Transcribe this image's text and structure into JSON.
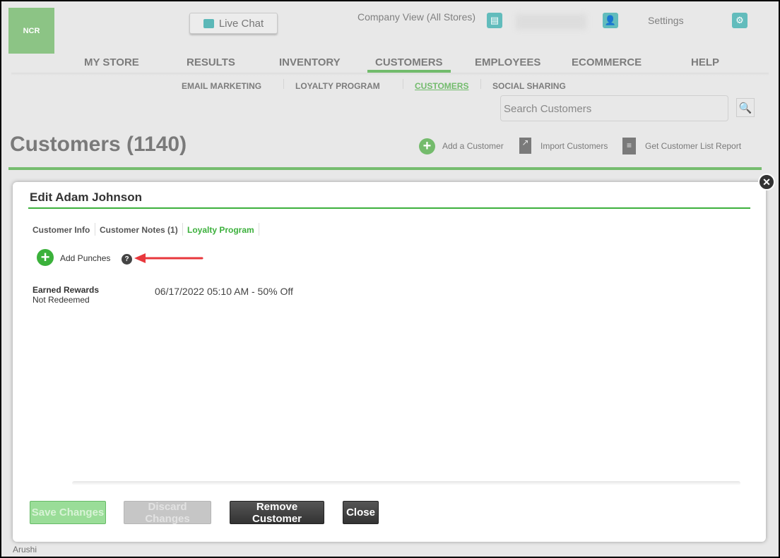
{
  "header": {
    "logo": "NCR",
    "live_chat": "Live Chat",
    "company_view": "Company View (All Stores)",
    "settings": "Settings"
  },
  "nav": {
    "items": [
      "MY STORE",
      "RESULTS",
      "INVENTORY",
      "CUSTOMERS",
      "EMPLOYEES",
      "ECOMMERCE",
      "HELP"
    ],
    "active": "CUSTOMERS"
  },
  "subnav": {
    "items": [
      "EMAIL MARKETING",
      "LOYALTY PROGRAM",
      "CUSTOMERS",
      "SOCIAL SHARING"
    ],
    "active": "CUSTOMERS"
  },
  "search": {
    "placeholder": "Search Customers"
  },
  "page": {
    "title": "Customers (1140)",
    "add": "Add a Customer",
    "import": "Import Customers",
    "report": "Get Customer List Report",
    "bg_row": "Arushi"
  },
  "modal": {
    "title": "Edit Adam Johnson",
    "tabs": [
      "Customer Info",
      "Customer Notes (1)",
      "Loyalty Program"
    ],
    "active_tab": "Loyalty Program",
    "add_punches": "Add Punches",
    "earned_rewards": "Earned Rewards",
    "status": "Not Redeemed",
    "reward": "06/17/2022 05:10 AM - 50% Off",
    "buttons": {
      "save": "Save Changes",
      "discard": "Discard Changes",
      "remove": "Remove Customer",
      "close": "Close"
    }
  },
  "colors": {
    "accent": "#3cb03c",
    "teal": "#62bcbc",
    "annotation_arrow": "#e8383d"
  }
}
